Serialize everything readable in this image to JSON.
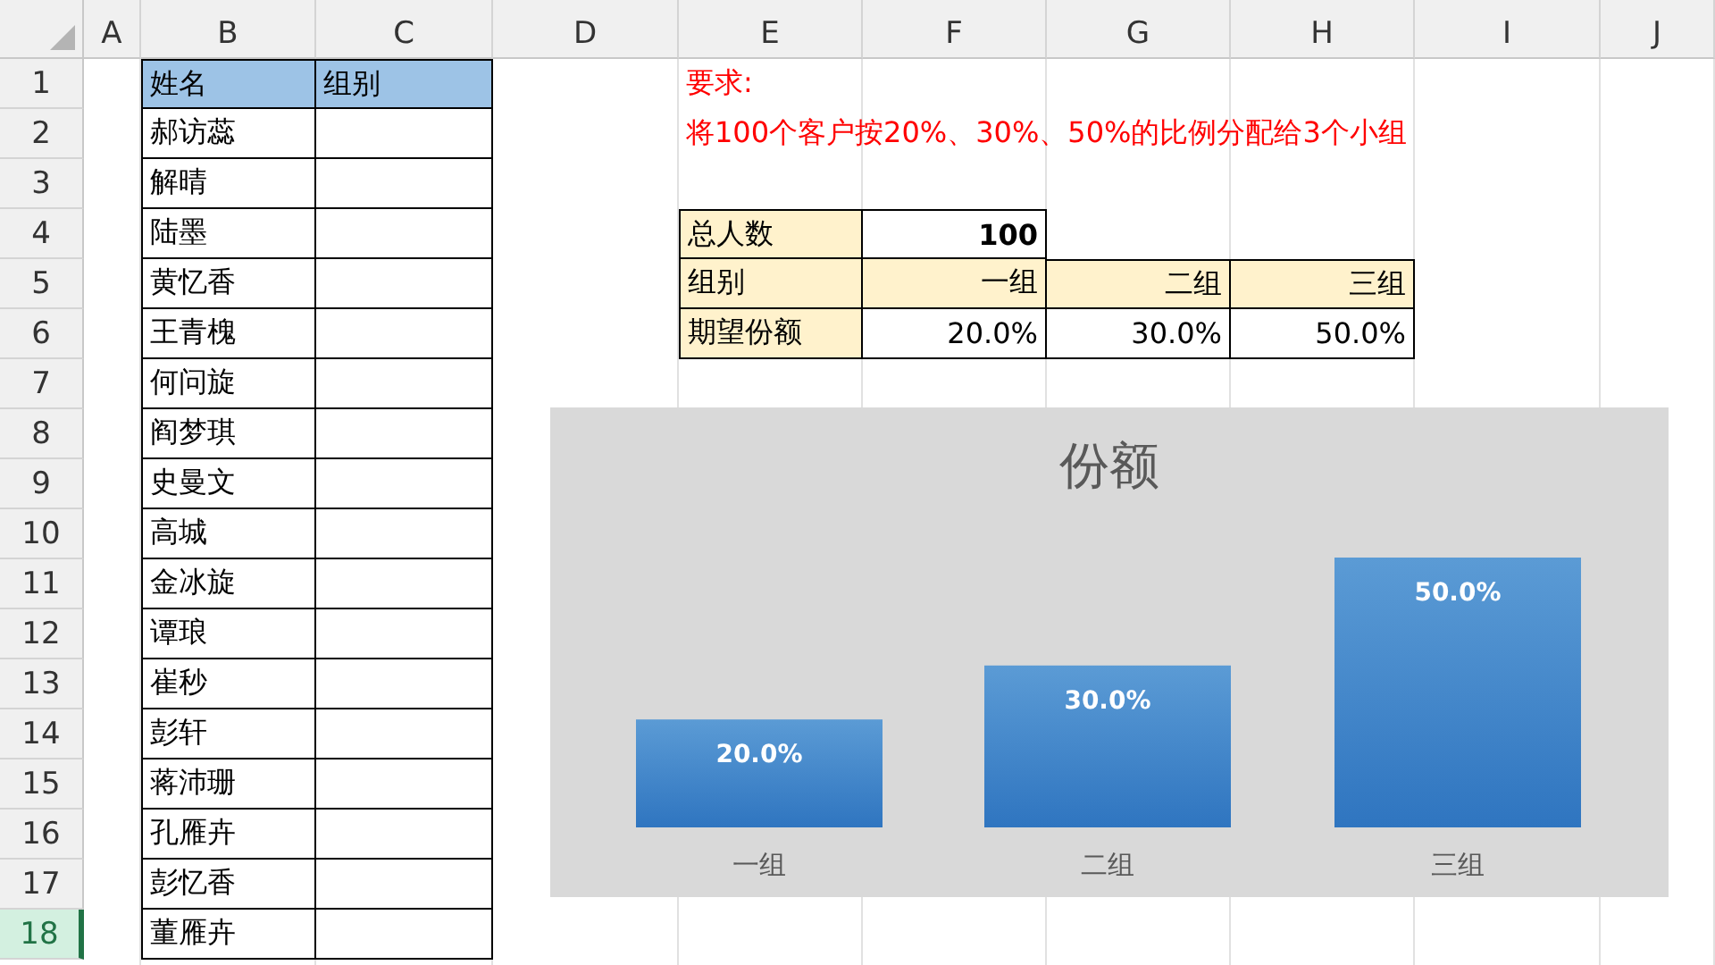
{
  "columns": [
    "A",
    "B",
    "C",
    "D",
    "E",
    "F",
    "G",
    "H",
    "I",
    "J"
  ],
  "rows": [
    {
      "label": "1",
      "selected": false
    },
    {
      "label": "2",
      "selected": false
    },
    {
      "label": "3",
      "selected": false
    },
    {
      "label": "4",
      "selected": false
    },
    {
      "label": "5",
      "selected": false
    },
    {
      "label": "6",
      "selected": false
    },
    {
      "label": "7",
      "selected": false
    },
    {
      "label": "8",
      "selected": false
    },
    {
      "label": "9",
      "selected": false
    },
    {
      "label": "10",
      "selected": false
    },
    {
      "label": "11",
      "selected": false
    },
    {
      "label": "12",
      "selected": false
    },
    {
      "label": "13",
      "selected": false
    },
    {
      "label": "14",
      "selected": false
    },
    {
      "label": "15",
      "selected": false
    },
    {
      "label": "16",
      "selected": false
    },
    {
      "label": "17",
      "selected": false
    },
    {
      "label": "18",
      "selected": true
    }
  ],
  "name_table": {
    "headers": [
      "姓名",
      "组别"
    ],
    "names": [
      "郝访蕊",
      "解晴",
      "陆墨",
      "黄忆香",
      "王青槐",
      "何问旋",
      "阎梦琪",
      "史曼文",
      "高城",
      "金冰旋",
      "谭琅",
      "崔秒",
      "彭轩",
      "蒋沛珊",
      "孔雁卉",
      "彭忆香",
      "董雁卉"
    ]
  },
  "requirement": {
    "title": "要求:",
    "text": "将100个客户按20%、30%、50%的比例分配给3个小组"
  },
  "summary": {
    "total_label": "总人数",
    "total_value": "100",
    "group_label": "组别",
    "groups": [
      "一组",
      "二组",
      "三组"
    ],
    "share_label": "期望份额",
    "shares": [
      "20.0%",
      "30.0%",
      "50.0%"
    ]
  },
  "chart": {
    "chart_data": {
      "type": "bar",
      "title": "份额",
      "categories": [
        "一组",
        "二组",
        "三组"
      ],
      "values": [
        20,
        30,
        50
      ],
      "value_labels": [
        "20.0%",
        "30.0%",
        "50.0%"
      ],
      "data_labels": true
    }
  }
}
